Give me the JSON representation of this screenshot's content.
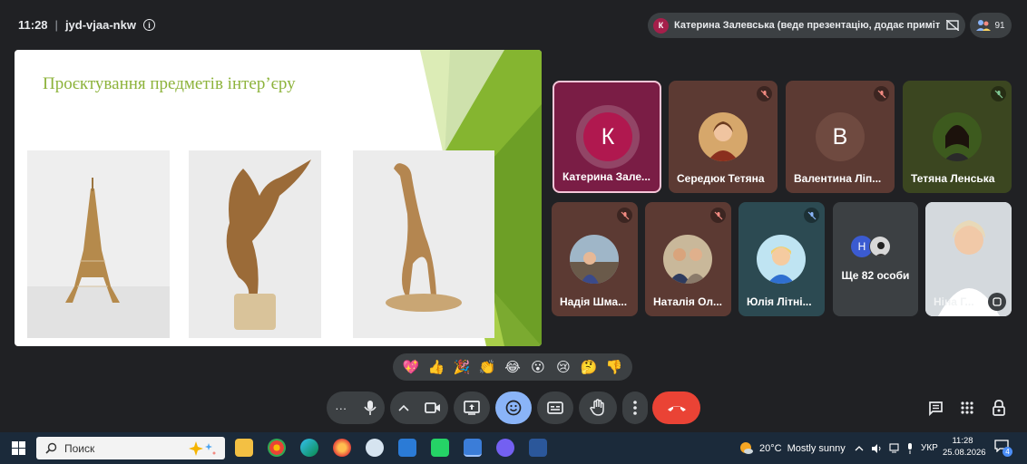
{
  "meeting": {
    "time": "11:28",
    "separator": "|",
    "code": "jyd-vjaa-nkw",
    "info_glyph": "i"
  },
  "presenter_chip": {
    "initial": "К",
    "text": "Катерина Залевська (веде презентацію, додає примітки)"
  },
  "participants_button": {
    "count": "91"
  },
  "slide": {
    "title": "Проєктування предметів інтер’єру"
  },
  "tiles": [
    {
      "name": "Катерина Зале...",
      "initial": "К",
      "color": "#b0184f"
    },
    {
      "name": "Середюк Тетяна"
    },
    {
      "name": "Валентина Ліп...",
      "initial": "В"
    },
    {
      "name": "Тетяна Ленська"
    },
    {
      "name": "Надія Шма..."
    },
    {
      "name": "Наталія Ол..."
    },
    {
      "name": "Юлія Літні..."
    },
    {
      "name": "Ще 82 особи",
      "initial": "Н"
    },
    {
      "name": "Ніна Г..."
    }
  ],
  "reactions": [
    "💖",
    "👍",
    "🎉",
    "👏",
    "😂",
    "😮",
    "😢",
    "🤔",
    "👎"
  ],
  "controls": {
    "more_dots": "···"
  },
  "taskbar": {
    "search_placeholder": "Поиск",
    "weather_temp": "20°C",
    "weather_desc": "Mostly sunny",
    "language": "УКР",
    "clock_time": "11:28",
    "clock_date": "25.08.2026",
    "notification_count": "4"
  },
  "colors": {
    "background": "#202124",
    "control_bg": "#3c4043",
    "end_call": "#ea4335",
    "active_control": "#8ab4f8",
    "slide_accent": "#8db33b"
  }
}
